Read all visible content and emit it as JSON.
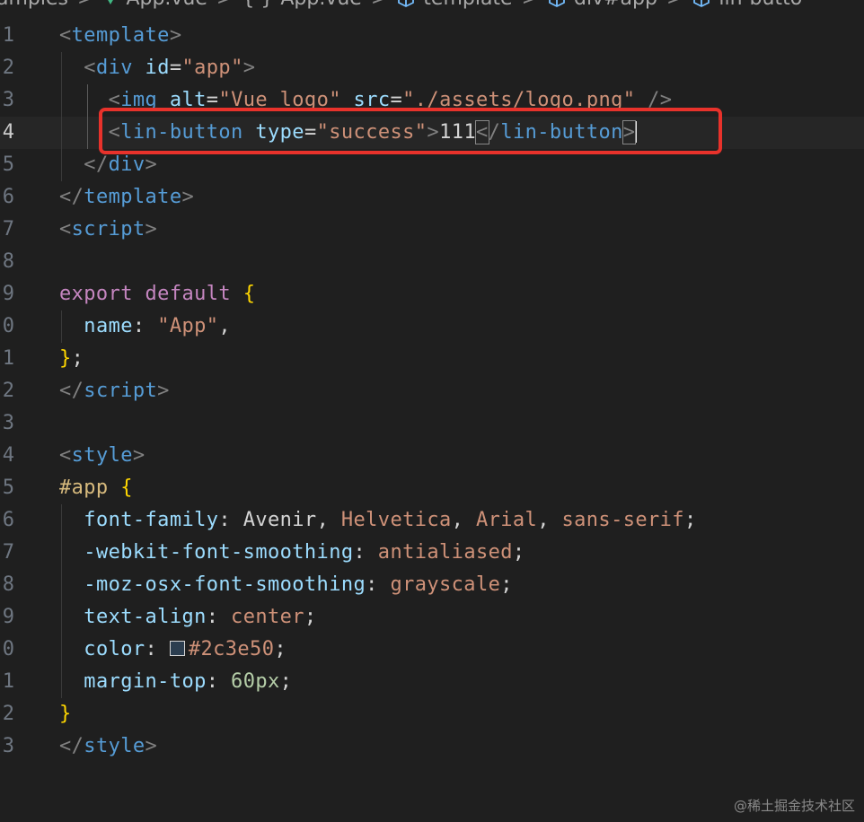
{
  "breadcrumb": {
    "items": [
      {
        "label": "amples",
        "icon": ""
      },
      {
        "label": "App.vue",
        "icon": "vue-icon"
      },
      {
        "label": "App.vue",
        "icon": "braces-icon",
        "prefix": "{ }"
      },
      {
        "label": "template",
        "icon": "cube-icon"
      },
      {
        "label": "div#app",
        "icon": "cube-icon"
      },
      {
        "label": "lin-butto",
        "icon": "cube-icon"
      }
    ],
    "separator": ">"
  },
  "editor": {
    "active_line": 4,
    "lines": [
      {
        "num": "1",
        "tokens": [
          [
            "t-bracket",
            "<"
          ],
          [
            "t-tag",
            "template"
          ],
          [
            "t-bracket",
            ">"
          ]
        ]
      },
      {
        "num": "2",
        "tokens": [
          [
            "t-plain",
            "  "
          ],
          [
            "t-bracket",
            "<"
          ],
          [
            "t-tag",
            "div"
          ],
          [
            "t-plain",
            " "
          ],
          [
            "t-attr",
            "id"
          ],
          [
            "t-plain",
            "="
          ],
          [
            "t-str",
            "\"app\""
          ],
          [
            "t-bracket",
            ">"
          ]
        ]
      },
      {
        "num": "3",
        "tokens": [
          [
            "t-plain",
            "    "
          ],
          [
            "t-bracket",
            "<"
          ],
          [
            "t-tag",
            "img"
          ],
          [
            "t-plain",
            " "
          ],
          [
            "t-attr",
            "alt"
          ],
          [
            "t-plain",
            "="
          ],
          [
            "t-str",
            "\"Vue logo\""
          ],
          [
            "t-plain",
            " "
          ],
          [
            "t-attr",
            "src"
          ],
          [
            "t-plain",
            "="
          ],
          [
            "t-str",
            "\"./assets/logo.png\""
          ],
          [
            "t-plain",
            " "
          ],
          [
            "t-bracket",
            "/>"
          ]
        ]
      },
      {
        "num": "4",
        "tokens": [
          [
            "t-plain",
            "    "
          ],
          [
            "t-bracket",
            "<"
          ],
          [
            "t-tag",
            "lin-button"
          ],
          [
            "t-plain",
            " "
          ],
          [
            "t-attr",
            "type"
          ],
          [
            "t-plain",
            "="
          ],
          [
            "t-str",
            "\"success\""
          ],
          [
            "t-bracket",
            ">"
          ],
          [
            "t-plain",
            "111"
          ],
          [
            "t-bracket match",
            "<"
          ],
          [
            "t-bracket",
            "/"
          ],
          [
            "t-tag",
            "lin-button"
          ],
          [
            "t-bracket match",
            ">"
          ]
        ]
      },
      {
        "num": "5",
        "tokens": [
          [
            "t-plain",
            "  "
          ],
          [
            "t-bracket",
            "</"
          ],
          [
            "t-tag",
            "div"
          ],
          [
            "t-bracket",
            ">"
          ]
        ]
      },
      {
        "num": "6",
        "tokens": [
          [
            "t-bracket",
            "</"
          ],
          [
            "t-tag",
            "template"
          ],
          [
            "t-bracket",
            ">"
          ]
        ]
      },
      {
        "num": "7",
        "tokens": [
          [
            "t-bracket",
            "<"
          ],
          [
            "t-tag",
            "script"
          ],
          [
            "t-bracket",
            ">"
          ]
        ]
      },
      {
        "num": "8",
        "tokens": []
      },
      {
        "num": "9",
        "tokens": [
          [
            "t-kw",
            "export"
          ],
          [
            "t-plain",
            " "
          ],
          [
            "t-kw",
            "default"
          ],
          [
            "t-plain",
            " "
          ],
          [
            "t-brace",
            "{"
          ]
        ]
      },
      {
        "num": "0",
        "tokens": [
          [
            "t-plain",
            "  "
          ],
          [
            "t-prop",
            "name"
          ],
          [
            "t-plain",
            ": "
          ],
          [
            "t-str",
            "\"App\""
          ],
          [
            "t-plain",
            ","
          ]
        ]
      },
      {
        "num": "1",
        "tokens": [
          [
            "t-brace",
            "}"
          ],
          [
            "t-plain",
            ";"
          ]
        ]
      },
      {
        "num": "2",
        "tokens": [
          [
            "t-bracket",
            "</"
          ],
          [
            "t-tag",
            "script"
          ],
          [
            "t-bracket",
            ">"
          ]
        ]
      },
      {
        "num": "3",
        "tokens": []
      },
      {
        "num": "4",
        "tokens": [
          [
            "t-bracket",
            "<"
          ],
          [
            "t-tag",
            "style"
          ],
          [
            "t-bracket",
            ">"
          ]
        ]
      },
      {
        "num": "5",
        "tokens": [
          [
            "t-sel",
            "#app"
          ],
          [
            "t-plain",
            " "
          ],
          [
            "t-brace",
            "{"
          ]
        ]
      },
      {
        "num": "6",
        "tokens": [
          [
            "t-plain",
            "  "
          ],
          [
            "t-prop",
            "font-family"
          ],
          [
            "t-plain",
            ": Avenir, "
          ],
          [
            "t-val",
            "Helvetica"
          ],
          [
            "t-plain",
            ", "
          ],
          [
            "t-val",
            "Arial"
          ],
          [
            "t-plain",
            ", "
          ],
          [
            "t-val",
            "sans-serif"
          ],
          [
            "t-plain",
            ";"
          ]
        ]
      },
      {
        "num": "7",
        "tokens": [
          [
            "t-plain",
            "  "
          ],
          [
            "t-prop",
            "-webkit-font-smoothing"
          ],
          [
            "t-plain",
            ": "
          ],
          [
            "t-val",
            "antialiased"
          ],
          [
            "t-plain",
            ";"
          ]
        ]
      },
      {
        "num": "8",
        "tokens": [
          [
            "t-plain",
            "  "
          ],
          [
            "t-prop",
            "-moz-osx-font-smoothing"
          ],
          [
            "t-plain",
            ": "
          ],
          [
            "t-val",
            "grayscale"
          ],
          [
            "t-plain",
            ";"
          ]
        ]
      },
      {
        "num": "9",
        "tokens": [
          [
            "t-plain",
            "  "
          ],
          [
            "t-prop",
            "text-align"
          ],
          [
            "t-plain",
            ": "
          ],
          [
            "t-val",
            "center"
          ],
          [
            "t-plain",
            ";"
          ]
        ]
      },
      {
        "num": "0",
        "tokens": [
          [
            "t-plain",
            "  "
          ],
          [
            "t-prop",
            "color"
          ],
          [
            "t-plain",
            ": "
          ],
          [
            "swatch",
            ""
          ],
          [
            "t-val",
            "#2c3e50"
          ],
          [
            "t-plain",
            ";"
          ]
        ]
      },
      {
        "num": "1",
        "tokens": [
          [
            "t-plain",
            "  "
          ],
          [
            "t-prop",
            "margin-top"
          ],
          [
            "t-plain",
            ": "
          ],
          [
            "t-num",
            "60px"
          ],
          [
            "t-plain",
            ";"
          ]
        ]
      },
      {
        "num": "2",
        "tokens": [
          [
            "t-brace",
            "}"
          ]
        ]
      },
      {
        "num": "3",
        "tokens": [
          [
            "t-bracket",
            "</"
          ],
          [
            "t-tag",
            "style"
          ],
          [
            "t-bracket",
            ">"
          ]
        ]
      },
      {
        "num": "",
        "tokens": []
      }
    ]
  },
  "colors": {
    "background": "#1f1f1f",
    "highlight_box": "#e8322b",
    "swatch_color": "#2c3e50"
  },
  "watermark": "@稀土掘金技术社区"
}
